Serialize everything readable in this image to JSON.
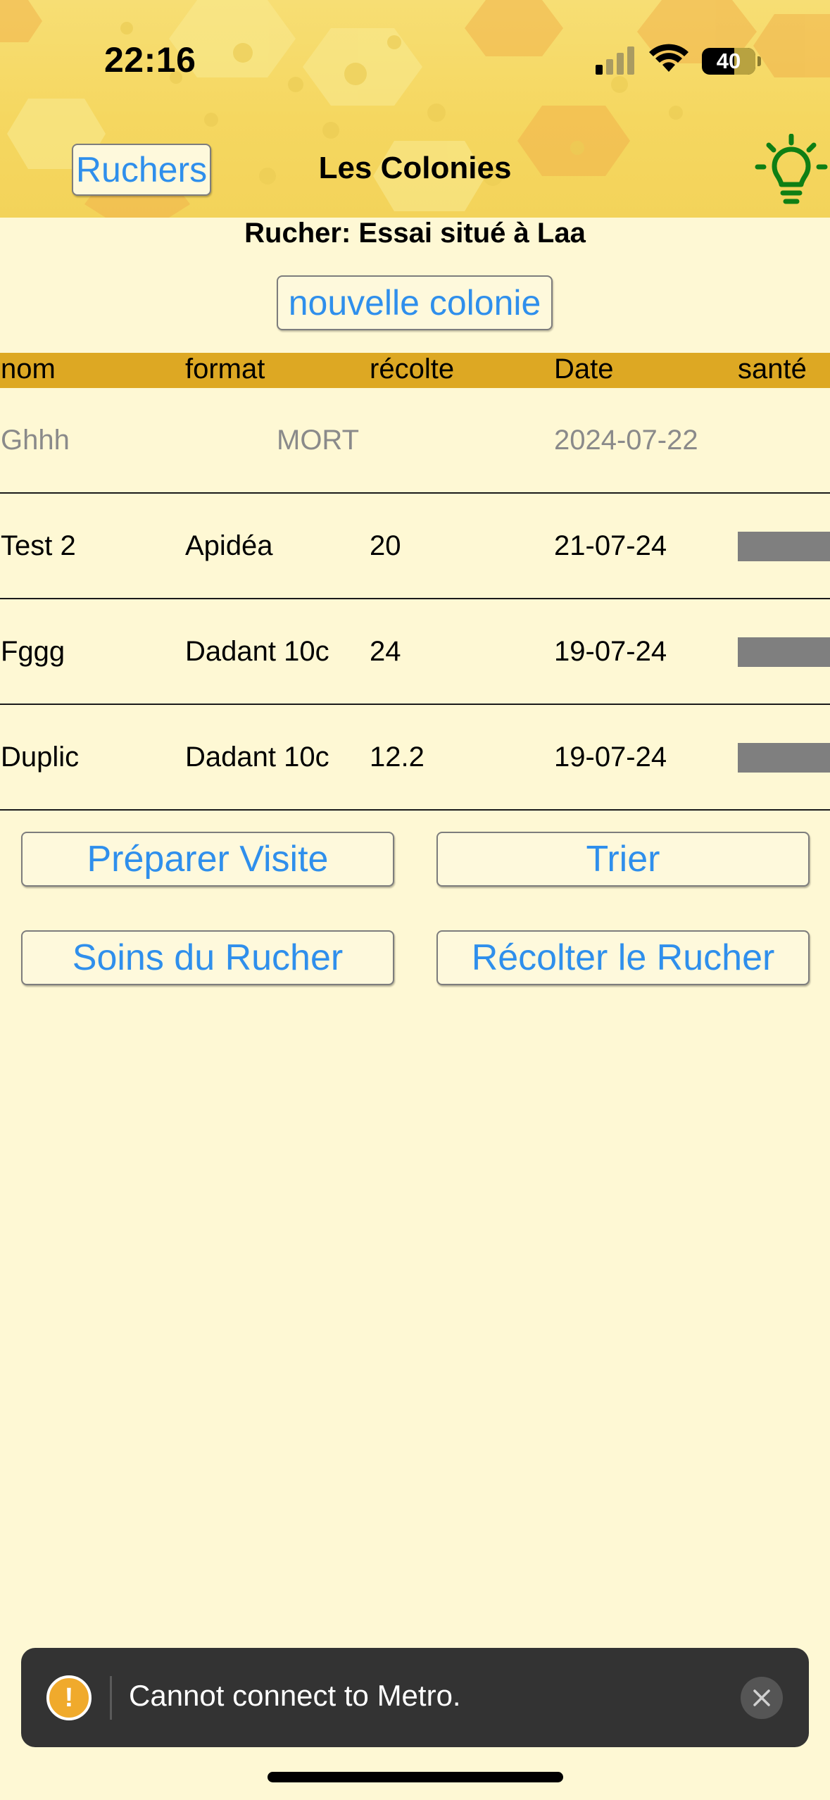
{
  "status_bar": {
    "time": "22:16",
    "battery_level": "40",
    "battery_fraction": 0.4
  },
  "nav": {
    "back_label": "Ruchers",
    "title": "Les Colonies",
    "help_icon": "lightbulb-icon",
    "help_icon_color": "#0f7f14"
  },
  "rucher": {
    "title": "Rucher: Essai situé à Laa",
    "new_colony_label": "nouvelle colonie"
  },
  "table": {
    "header_color": "#dda823",
    "columns": [
      "nom",
      "format",
      "récolte",
      "Date",
      "santé"
    ],
    "rows": [
      {
        "nom": "Ghhh",
        "format": "",
        "recolte": "MORT",
        "date": "2024-07-22",
        "status": "dead"
      },
      {
        "nom": "Test 2",
        "format": "Apidéa",
        "recolte": "20",
        "date": "21-07-24",
        "status": "alive"
      },
      {
        "nom": "Fggg",
        "format": "Dadant 10c",
        "recolte": "24",
        "date": "19-07-24",
        "status": "alive"
      },
      {
        "nom": "Duplic",
        "format": "Dadant 10c",
        "recolte": "12.2",
        "date": "19-07-24",
        "status": "alive"
      }
    ]
  },
  "actions": {
    "prepare_visit": "Préparer Visite",
    "sort": "Trier",
    "care": "Soins du Rucher",
    "harvest": "Récolter le Rucher"
  },
  "toast": {
    "message": "Cannot connect to Metro.",
    "icon": "warning-icon",
    "close_icon": "close-icon",
    "warning_color": "#f0aa2c"
  },
  "colors": {
    "background": "#fef8d4",
    "link": "#2f8fec"
  }
}
